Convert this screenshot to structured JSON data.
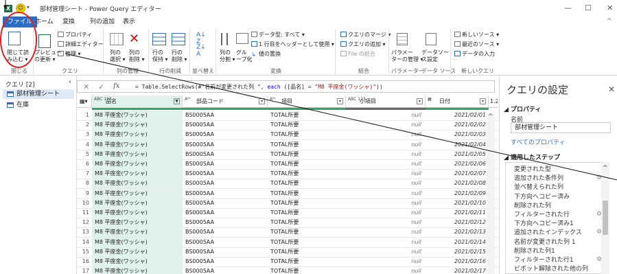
{
  "window": {
    "title": "部材管理シート - Power Query エディター",
    "app_icon": "excel-icon",
    "qa_dropdown": "▾",
    "min": "—",
    "max": "☐",
    "close": "✕"
  },
  "tabs": [
    {
      "label": "ファイル",
      "active": true
    },
    {
      "label": "ホーム",
      "active": false
    },
    {
      "label": "変換",
      "active": false
    },
    {
      "label": "列の追加",
      "active": false
    },
    {
      "label": "表示",
      "active": false
    }
  ],
  "ribbon": {
    "close_load": {
      "line1": "閉じて読",
      "line2": "み込む ▾",
      "group": "閉じる"
    },
    "preview": {
      "line1": "プレビュー",
      "line2": "の更新 ▾"
    },
    "properties": "プロパティ",
    "advanced_editor": "詳細エディター",
    "manage": "管理 ▾",
    "query_group": "クエリ",
    "choose_columns": {
      "line1": "列の",
      "line2": "選択 ▾"
    },
    "remove_columns": {
      "line1": "列の",
      "line2": "削除 ▾"
    },
    "columns_group": "列の管理",
    "keep_rows": {
      "line1": "行の",
      "line2": "保持 ▾"
    },
    "remove_rows": {
      "line1": "行の",
      "line2": "削除 ▾"
    },
    "rows_group": "行の削減",
    "sort_group": "並べ替え",
    "split_column": {
      "line1": "列の",
      "line2": "分割 ▾"
    },
    "group_by": {
      "line1": "グル",
      "line2": "ープ化"
    },
    "data_type": "データ型: すべて ▾",
    "use_header": "1 行目をヘッダーとして使用 ▾",
    "replace_values": "値の置換",
    "transform_group": "変換",
    "merge_queries": "クエリのマージ ▾",
    "append_queries": "クエリの追加 ▾",
    "combine_files": "File の結合",
    "combine_group": "結合",
    "manage_params": {
      "line1": "パラメー",
      "line2": "ターの管理 ▾"
    },
    "params_group": "パラメーター",
    "data_source": {
      "line1": "データソー",
      "line2": "ス設定"
    },
    "datasource_group": "データ ソース",
    "new_source": "新しいソース ▾",
    "recent_sources": "最近のソース ▾",
    "enter_data": "データの入力",
    "new_query_group": "新しいクエリ"
  },
  "queries": {
    "title": "クエリ [2]",
    "collapse": "‹",
    "items": [
      {
        "label": "部材管理シート",
        "selected": true
      },
      {
        "label": "在庫",
        "selected": false
      }
    ]
  },
  "formula": {
    "cancel": "✕",
    "commit": "✓",
    "fx": "fx",
    "prefix": "= Table.SelectRows(#\"名前が変更された列 \", ",
    "each": "each",
    "middle": " ([品名] = ",
    "literal": "\"M8 平座金(ワッシャ)\"",
    "suffix": "))",
    "expand": "⌄"
  },
  "grid": {
    "columns": [
      {
        "label": "品名",
        "type": "ABC\n123",
        "filter": "▼"
      },
      {
        "label": "部品コード",
        "type": "Aᴮᶜ",
        "filter": "▾"
      },
      {
        "label": "項目",
        "type": "Aᴮᶜ",
        "filter": "▾"
      },
      {
        "label": "小項目",
        "type": "ABC\n123",
        "filter": "▾"
      },
      {
        "label": "日付",
        "type": "▦",
        "filter": "▾"
      },
      {
        "label": "1.2",
        "type": "",
        "filter": ""
      }
    ],
    "rows": [
      [
        "1",
        "M8 平座金(ワッシャ)",
        "BS0005AA",
        "TOTAL所要",
        "null",
        "2021/02/01"
      ],
      [
        "2",
        "M8 平座金(ワッシャ)",
        "BS0005AA",
        "TOTAL所要",
        "null",
        "2021/02/02"
      ],
      [
        "3",
        "M8 平座金(ワッシャ)",
        "BS0005AA",
        "TOTAL所要",
        "null",
        "2021/02/03"
      ],
      [
        "4",
        "M8 平座金(ワッシャ)",
        "BS0005AA",
        "TOTAL所要",
        "null",
        "2021/02/04"
      ],
      [
        "5",
        "M8 平座金(ワッシャ)",
        "BS0005AA",
        "TOTAL所要",
        "null",
        "2021/02/05"
      ],
      [
        "6",
        "M8 平座金(ワッシャ)",
        "BS0005AA",
        "TOTAL所要",
        "null",
        "2021/02/06"
      ],
      [
        "7",
        "M8 平座金(ワッシャ)",
        "BS0005AA",
        "TOTAL所要",
        "null",
        "2021/02/07"
      ],
      [
        "8",
        "M8 平座金(ワッシャ)",
        "BS0005AA",
        "TOTAL所要",
        "null",
        "2021/02/08"
      ],
      [
        "9",
        "M8 平座金(ワッシャ)",
        "BS0005AA",
        "TOTAL所要",
        "null",
        "2021/02/09"
      ],
      [
        "10",
        "M8 平座金(ワッシャ)",
        "BS0005AA",
        "TOTAL所要",
        "null",
        "2021/02/10"
      ],
      [
        "11",
        "M8 平座金(ワッシャ)",
        "BS0005AA",
        "TOTAL所要",
        "null",
        "2021/02/11"
      ],
      [
        "12",
        "M8 平座金(ワッシャ)",
        "BS0005AA",
        "TOTAL所要",
        "null",
        "2021/02/12"
      ],
      [
        "13",
        "M8 平座金(ワッシャ)",
        "BS0005AA",
        "TOTAL所要",
        "null",
        "2021/02/13"
      ],
      [
        "14",
        "M8 平座金(ワッシャ)",
        "BS0005AA",
        "TOTAL所要",
        "null",
        "2021/02/14"
      ],
      [
        "15",
        "M8 平座金(ワッシャ)",
        "BS0005AA",
        "TOTAL所要",
        "null",
        "2021/02/15"
      ],
      [
        "16",
        "M8 平座金(ワッシャ)",
        "BS0005AA",
        "TOTAL所要",
        "null",
        "2021/02/16"
      ],
      [
        "17",
        "M8 平座金(ワッシャ)",
        "BS0005AA",
        "TOTAL所要",
        "null",
        "2021/02/17"
      ]
    ]
  },
  "settings": {
    "title": "クエリの設定",
    "close": "✕",
    "properties_heading": "◢ プロパティ",
    "name_label": "名前",
    "name_value": "部材管理シート",
    "all_properties": "すべてのプロパティ",
    "steps_heading": "◢ 適用したステップ",
    "steps": [
      {
        "label": "変更された型",
        "gear": false
      },
      {
        "label": "追加された条件列",
        "gear": true
      },
      {
        "label": "並べ替えられた列",
        "gear": false
      },
      {
        "label": "下方向へコピー済み",
        "gear": false
      },
      {
        "label": "削除された列",
        "gear": false
      },
      {
        "label": "フィルターされた行",
        "gear": true
      },
      {
        "label": "下方向へコピー済み1",
        "gear": false
      },
      {
        "label": "追加されたインデックス",
        "gear": true
      },
      {
        "label": "名前が変更された列 1",
        "gear": false
      },
      {
        "label": "削除された列1",
        "gear": false
      },
      {
        "label": "フィルターされた行1",
        "gear": true
      },
      {
        "label": "ピボット解除された他の列",
        "gear": false
      }
    ],
    "gear_icon": "⚙",
    "scroll_up": "^"
  },
  "colors": {
    "file_tab": "#2b6cc4",
    "selected_column": "#e1f2ea",
    "annotation_red": "#e02020",
    "link": "#2b6cc4"
  }
}
